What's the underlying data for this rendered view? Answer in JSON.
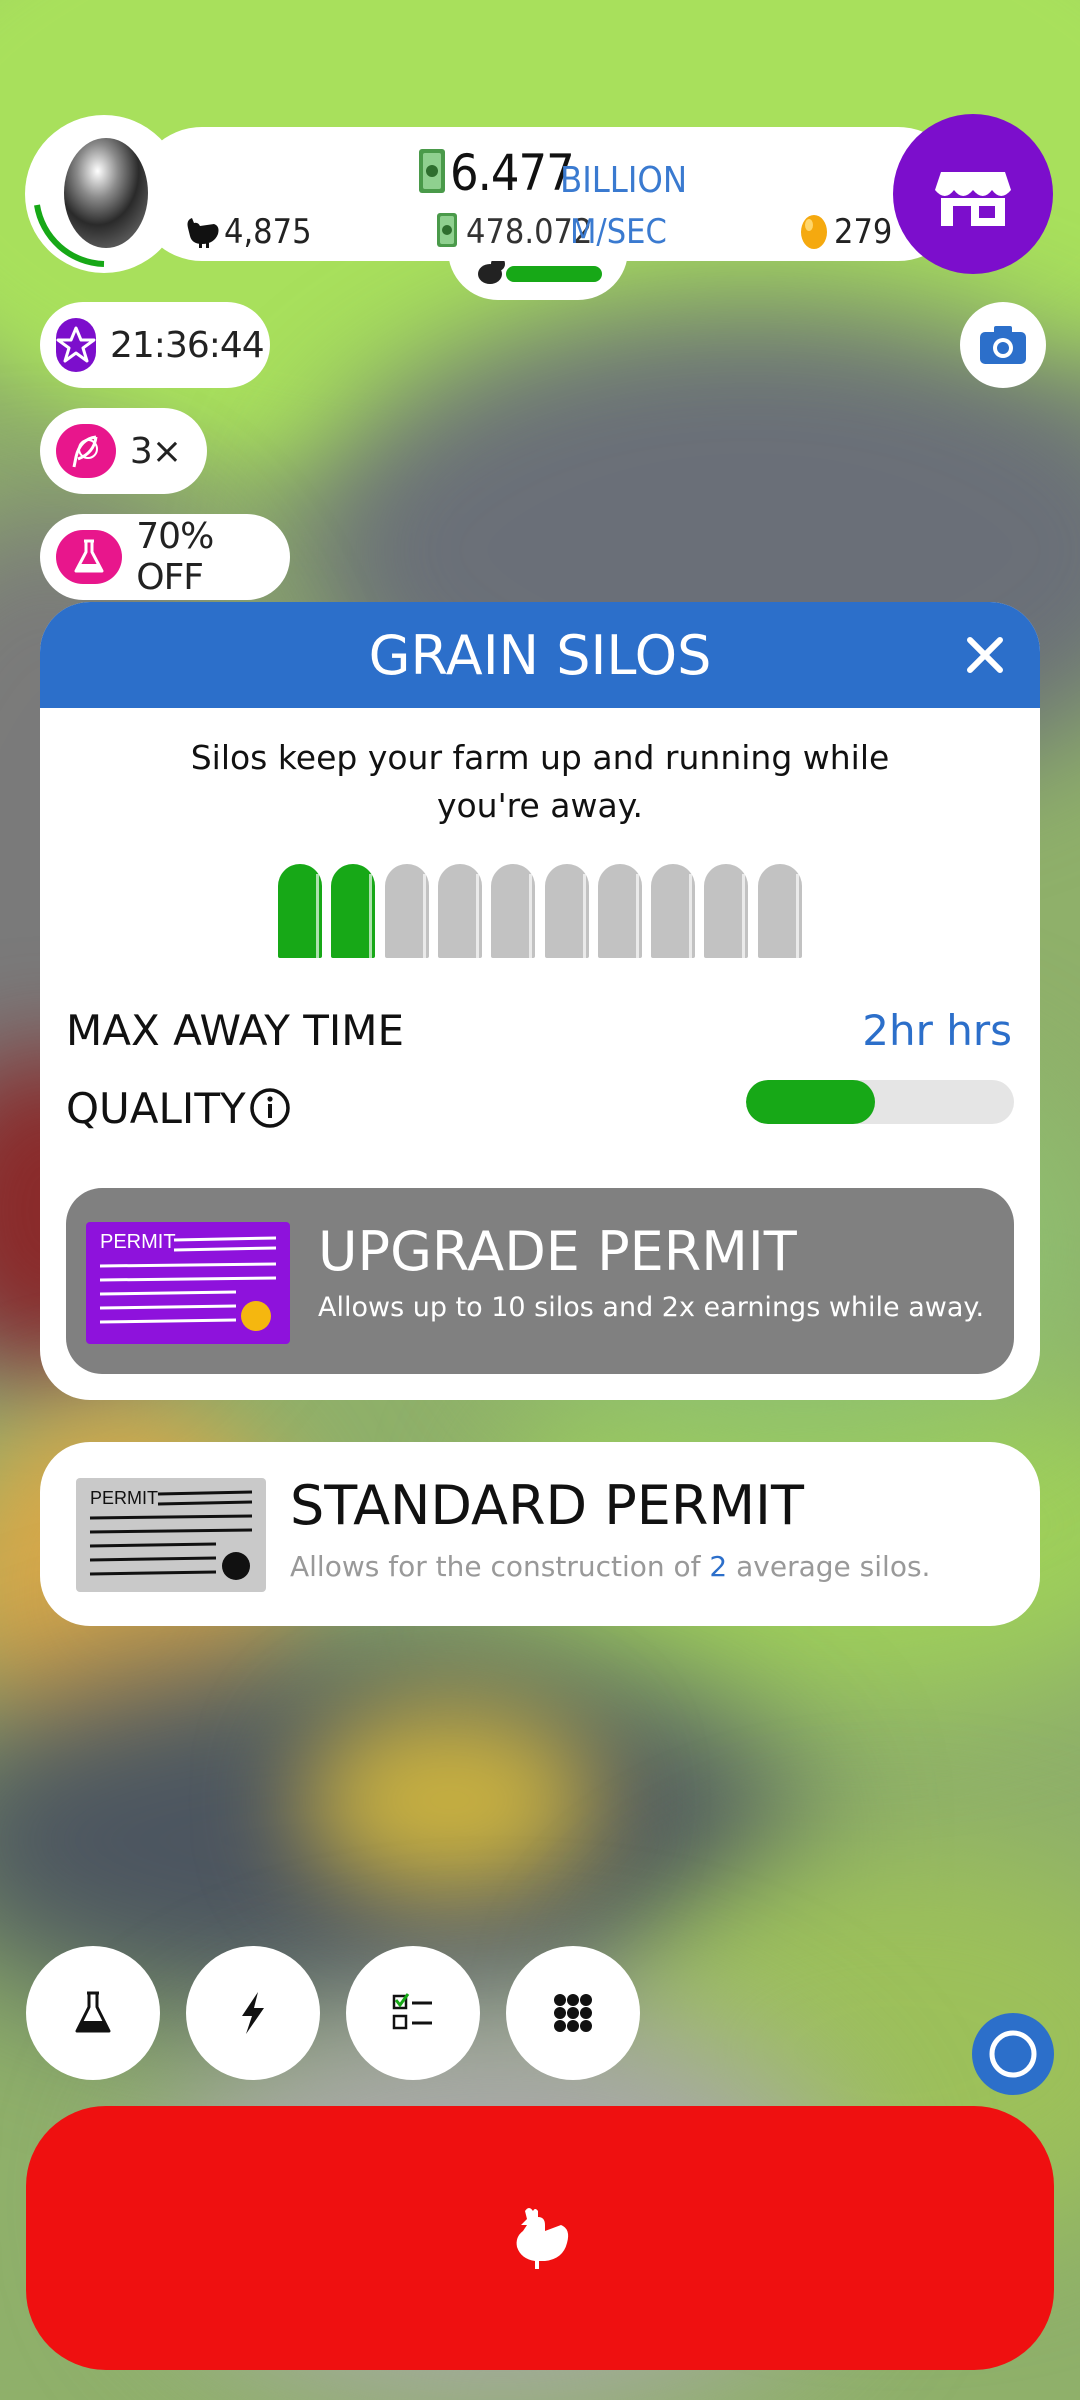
{
  "hud": {
    "money_value": "6.477",
    "money_unit": "BILLION",
    "rate_value": "478.072",
    "rate_unit": "M/SEC",
    "chickens": "4,875",
    "golden_eggs": "279"
  },
  "boosts": {
    "timer": "21:36:44",
    "multiplier": "3×",
    "discount": "70% OFF"
  },
  "dialog": {
    "title": "GRAIN SILOS",
    "description": "Silos keep your farm up and running while you're away.",
    "silos_owned": 2,
    "silos_total": 10,
    "max_away_label": "MAX AWAY TIME",
    "max_away_value": "2hr hrs",
    "quality_label": "QUALITY",
    "quality_level": 0.48,
    "upgrade": {
      "permit_word": "PERMIT",
      "title": "UPGRADE PERMIT",
      "description": "Allows up to 10 silos and 2x earnings while away."
    }
  },
  "standard_permit": {
    "permit_word": "PERMIT",
    "title": "STANDARD PERMIT",
    "desc_prefix": "Allows for the construction of",
    "desc_count": "2",
    "desc_suffix": "average silos."
  },
  "icons": {
    "shop": "shop-icon",
    "camera": "camera-icon",
    "star": "star-icon",
    "feather": "feather-icon",
    "flask": "flask-icon",
    "close": "close-icon",
    "info": "info-icon",
    "lightning": "lightning-icon",
    "checklist": "checklist-icon",
    "grid": "grid-icon",
    "chicken": "chicken-icon"
  },
  "colors": {
    "accent_blue": "#2c6fca",
    "shop_purple": "#7c0ecc",
    "boost_purple": "#7c0ecc",
    "boost_pink": "#e8168c",
    "silo_active": "#17a817",
    "silo_inactive": "#c2c2c2",
    "hatch_red": "#ef1010"
  }
}
